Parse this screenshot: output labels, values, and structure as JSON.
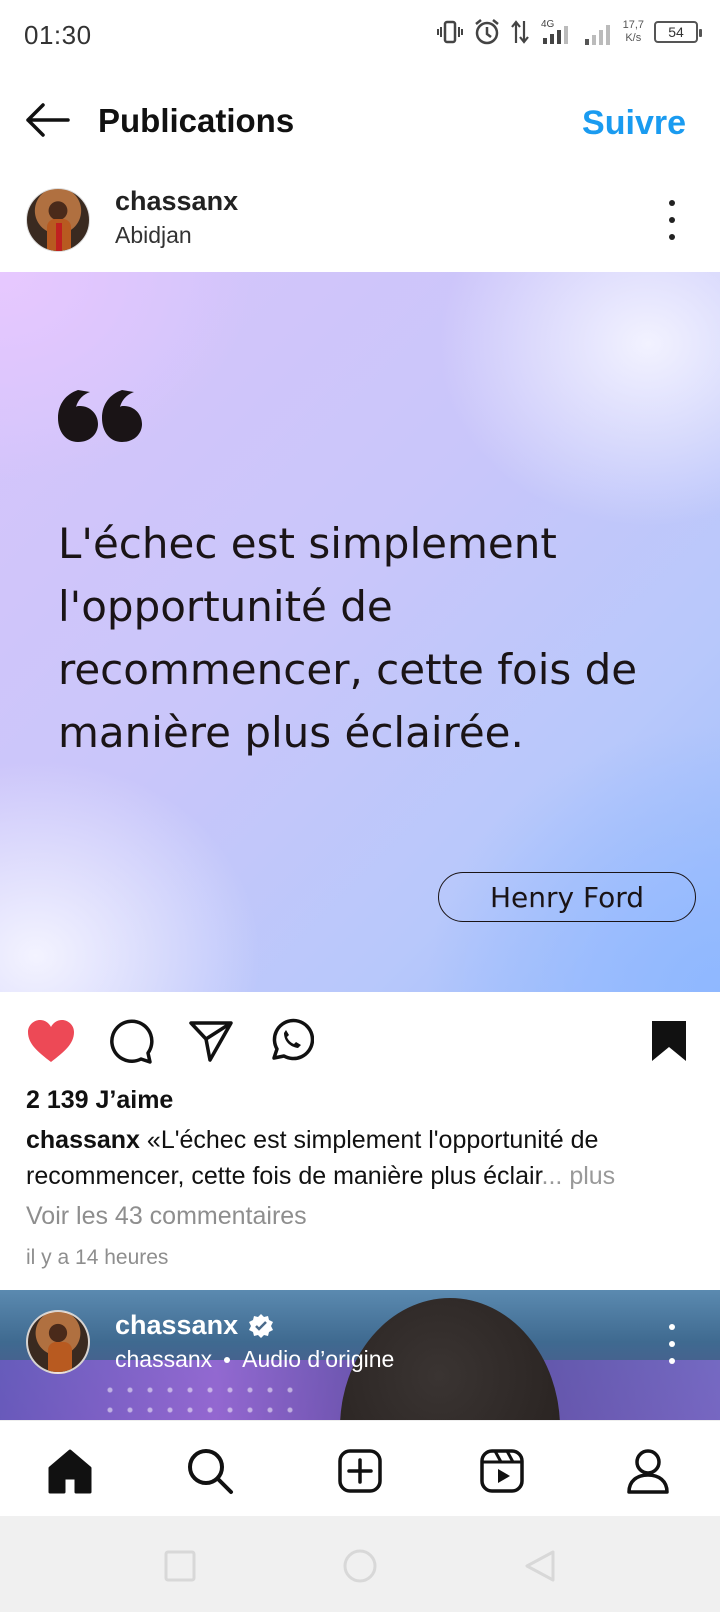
{
  "status_bar": {
    "time": "01:30",
    "network": "4G",
    "speed_value": "17,7",
    "speed_unit": "K/s",
    "battery": "54"
  },
  "header": {
    "title": "Publications",
    "follow_label": "Suivre"
  },
  "post": {
    "username": "chassanx",
    "location": "Abidjan",
    "quote_text": "L'échec est simplement l'opportunité de recommencer, cette fois de manière plus éclairée.",
    "author": "Henry Ford",
    "likes": "2 139 J’aime",
    "caption_user": "chassanx",
    "caption_text": "«L'échec est simplement l'opportunité de recommencer, cette fois de manière plus éclair",
    "caption_ellipsis": "...",
    "caption_more": "plus",
    "comments_link": "Voir les 43 commentaires",
    "time_ago": "il y a 14 heures"
  },
  "next_post": {
    "username": "chassanx",
    "sub_user": "chassanx",
    "audio": "Audio d’origine"
  },
  "colors": {
    "accent": "#1a9bf0",
    "like": "#ed4956"
  },
  "icons": {
    "back": "arrow-left-icon",
    "like": "heart-icon",
    "comment": "comment-icon",
    "share": "send-icon",
    "whatsapp": "whatsapp-icon",
    "save": "bookmark-icon",
    "nav": [
      "home-icon",
      "search-icon",
      "create-icon",
      "reels-icon",
      "profile-icon"
    ]
  }
}
